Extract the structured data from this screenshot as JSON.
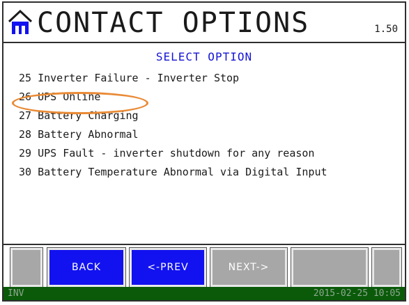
{
  "header": {
    "title": "CONTACT OPTIONS",
    "version": "1.50",
    "home_icon": "home-icon"
  },
  "subtitle": "SELECT OPTION",
  "options": [
    {
      "label": "25 Inverter Failure - Inverter Stop"
    },
    {
      "label": "26 UPS Online"
    },
    {
      "label": "27 Battery Charging"
    },
    {
      "label": "28 Battery Abnormal"
    },
    {
      "label": "29 UPS Fault - inverter shutdown for any reason"
    },
    {
      "label": "30 Battery Temperature Abnormal via Digital Input"
    }
  ],
  "buttons": {
    "back": "BACK",
    "prev": "<-PREV",
    "next": "NEXT->"
  },
  "status": {
    "left": "INV",
    "right": "2015-02-25 10:05"
  },
  "colors": {
    "title_blue": "#1414d4",
    "button_blue": "#1212f0",
    "button_gray": "#a7a7a7",
    "status_green": "#0a5a0a",
    "highlight_orange": "#e98a35"
  }
}
